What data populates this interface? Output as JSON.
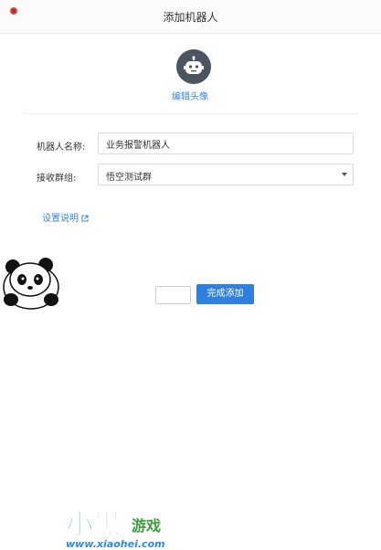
{
  "dialog": {
    "title": "添加机器人",
    "edit_avatar_label": "编辑头像",
    "fields": {
      "name_label": "机器人名称:",
      "name_value": "业务报警机器人",
      "group_label": "接收群组:",
      "group_value": "悟空测试群"
    },
    "help_link": "设置说明",
    "confirm_button": "完成添加",
    "icons": {
      "close": "close-icon",
      "avatar": "robot-icon",
      "external": "external-link-icon",
      "dropdown": "chevron-down-icon"
    },
    "colors": {
      "accent": "#2e7fe0",
      "link": "#3a87d8",
      "avatar_bg": "#4b5562",
      "close": "#e8453c"
    }
  },
  "watermark": {
    "brand": "小黑游戏",
    "brand_main": "小黑",
    "brand_sub": "游戏",
    "url": "www.xiaohei.com"
  }
}
